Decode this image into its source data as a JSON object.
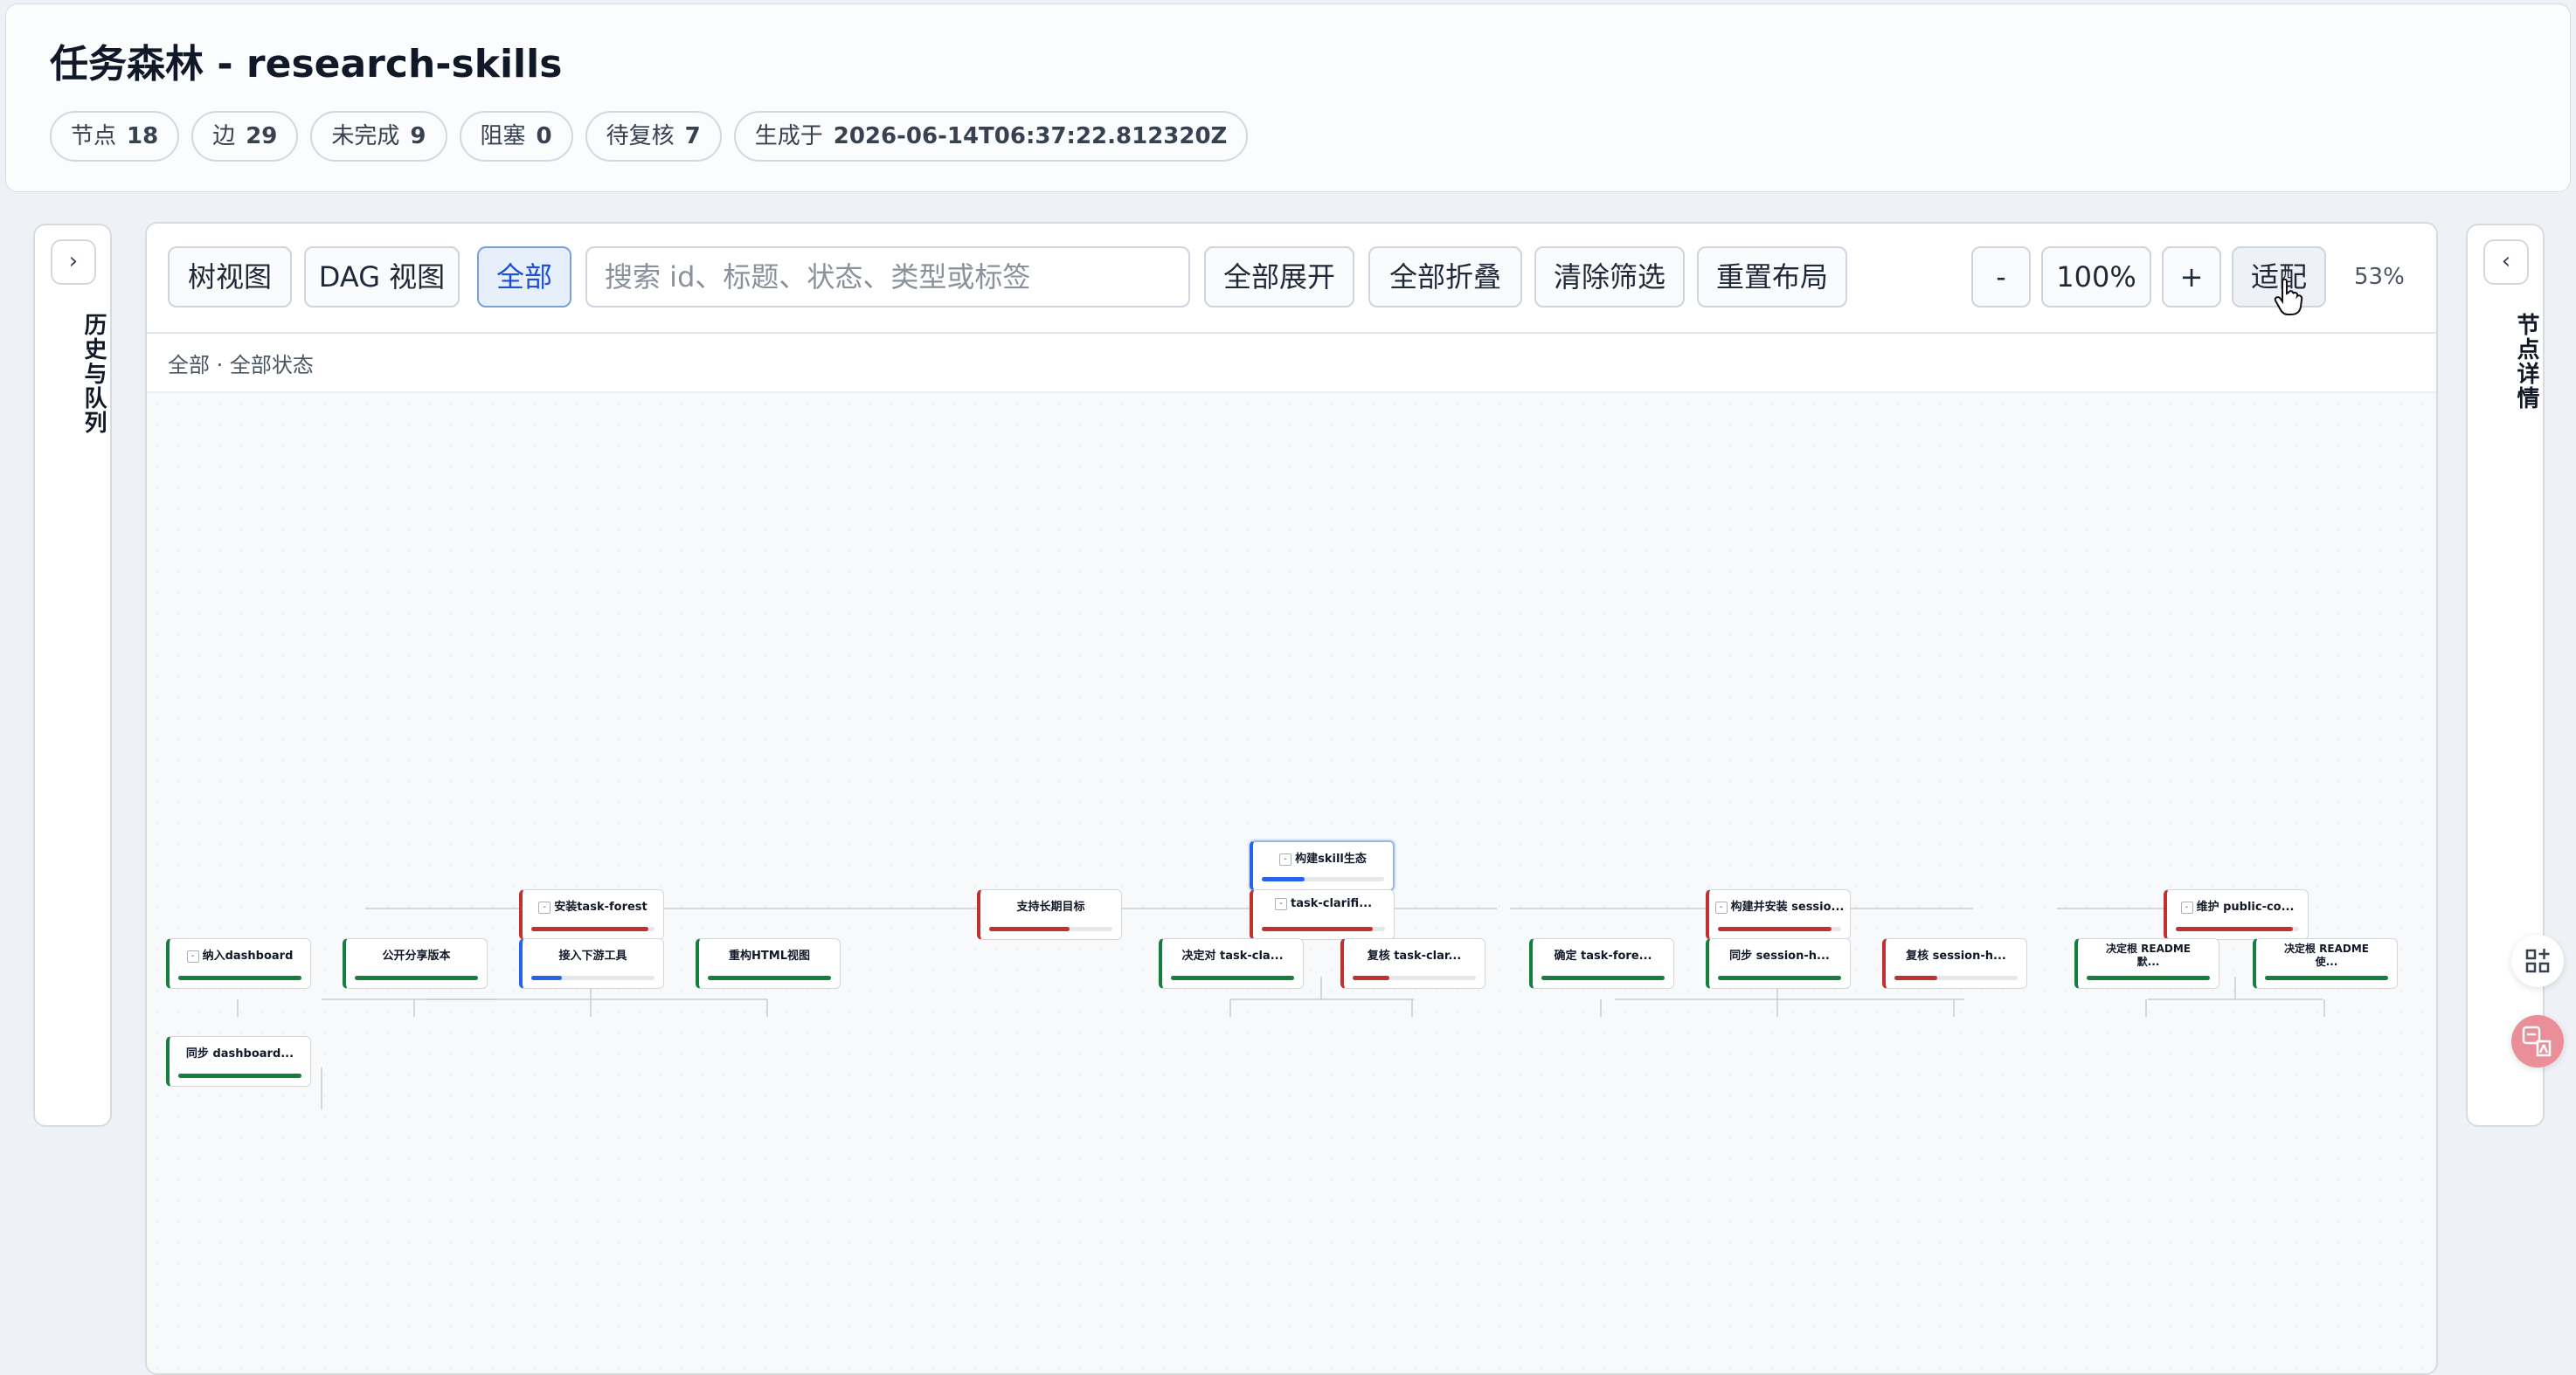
{
  "header": {
    "title": "任务森林 - research-skills",
    "chips": [
      {
        "label": "节点",
        "value": "18"
      },
      {
        "label": "边",
        "value": "29"
      },
      {
        "label": "未完成",
        "value": "9"
      },
      {
        "label": "阻塞",
        "value": "0"
      },
      {
        "label": "待复核",
        "value": "7"
      },
      {
        "label": "生成于",
        "value": "2026-06-14T06:37:22.812320Z"
      }
    ]
  },
  "left_panel": {
    "toggle": "›",
    "label": "历史与队列"
  },
  "right_panel": {
    "toggle": "‹",
    "label": "节点详情"
  },
  "toolbar": {
    "tree_view": "树视图",
    "dag_view": "DAG 视图",
    "all_filter": "全部",
    "search_placeholder": "搜索 id、标题、状态、类型或标签",
    "expand_all": "全部展开",
    "collapse_all": "全部折叠",
    "clear_filters": "清除筛选",
    "reset_layout": "重置布局",
    "zoom_out": "-",
    "zoom_value": "100%",
    "zoom_in": "+",
    "fit": "适配",
    "zoom_readout": "53%"
  },
  "filter_status": "全部 · 全部状态",
  "colors": {
    "done": "#15803d",
    "active": "#2563eb",
    "blocked": "#c0312f"
  },
  "nodes": [
    {
      "title": "构建skill生态",
      "status": "active",
      "progress": 0.35,
      "toggle": true,
      "selected": true
    },
    {
      "title": "安装task-forest",
      "status": "blocked",
      "progress": 0.95,
      "toggle": true
    },
    {
      "title": "支持长期目标",
      "status": "blocked",
      "progress": 0.65
    },
    {
      "title": "task-clarifi...",
      "status": "blocked",
      "progress": 0.9,
      "toggle": true
    },
    {
      "title": "构建并安装 sessio...",
      "status": "blocked",
      "progress": 0.92,
      "toggle": true
    },
    {
      "title": "维护 public-co...",
      "status": "blocked",
      "progress": 0.95,
      "toggle": true
    },
    {
      "title": "纳入dashboard",
      "status": "done",
      "progress": 1,
      "toggle": true
    },
    {
      "title": "公开分享版本",
      "status": "done",
      "progress": 1
    },
    {
      "title": "接入下游工具",
      "status": "active",
      "progress": 0.25
    },
    {
      "title": "重构HTML视图",
      "status": "done",
      "progress": 1
    },
    {
      "title": "决定对 task-cla...",
      "status": "done",
      "progress": 1
    },
    {
      "title": "复核 task-clar...",
      "status": "blocked",
      "progress": 0.3
    },
    {
      "title": "确定 task-fore...",
      "status": "done",
      "progress": 1
    },
    {
      "title": "同步 session-h...",
      "status": "done",
      "progress": 1
    },
    {
      "title": "复核 session-h...",
      "status": "blocked",
      "progress": 0.35
    },
    {
      "title": "决定根 README 默...",
      "status": "done",
      "progress": 1
    },
    {
      "title": "决定根 README 使...",
      "status": "done",
      "progress": 1
    },
    {
      "title": "同步 dashboard...",
      "status": "done",
      "progress": 1
    }
  ]
}
